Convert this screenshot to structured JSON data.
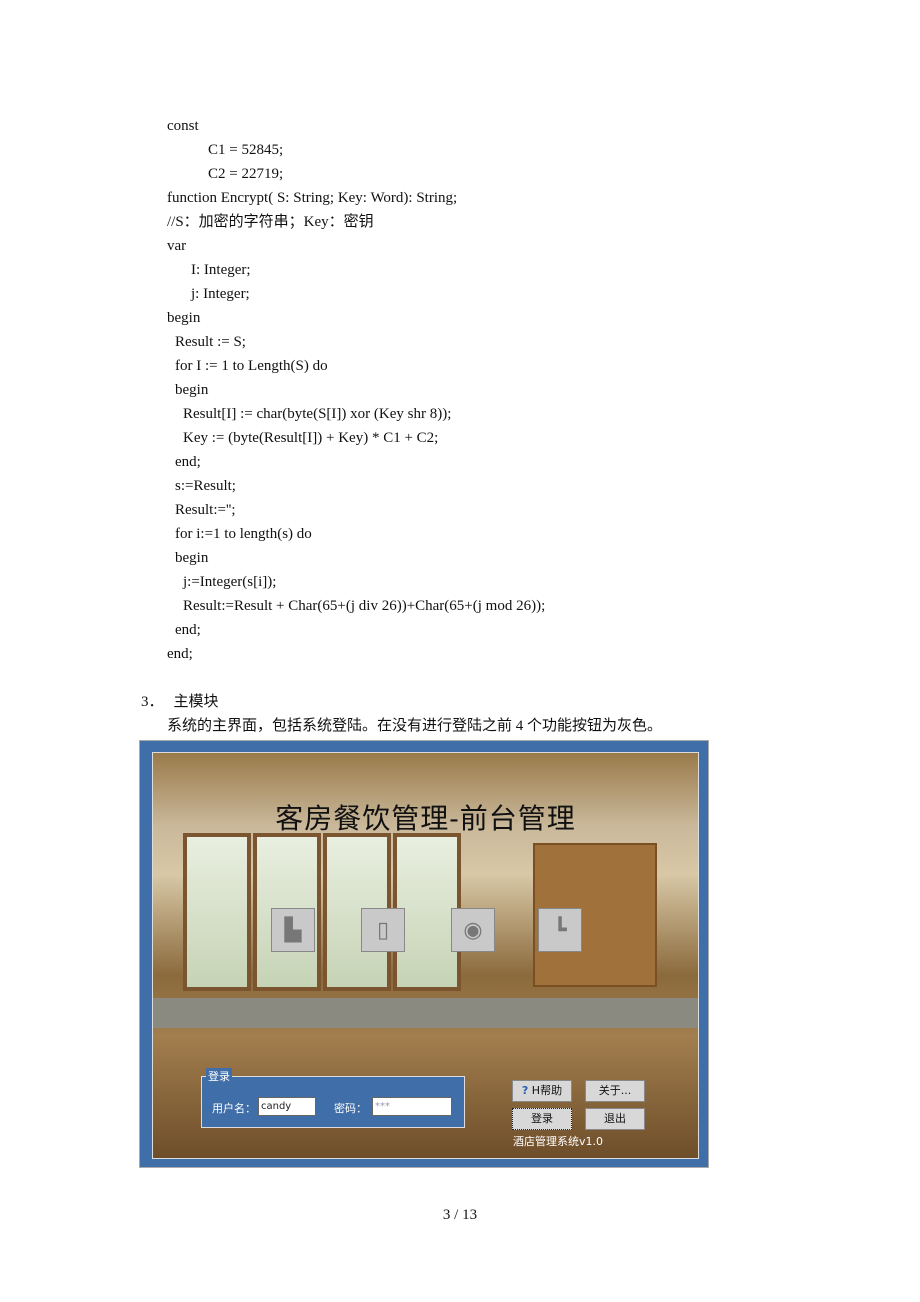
{
  "code_lines": [
    {
      "indent": 167,
      "text": "const"
    },
    {
      "indent": 208,
      "text": "C1 = 52845;"
    },
    {
      "indent": 208,
      "text": "C2 = 22719;"
    },
    {
      "indent": 167,
      "text": "function Encrypt( S: String; Key: Word): String;"
    },
    {
      "indent": 167,
      "text": "//S：加密的字符串；Key：密钥"
    },
    {
      "indent": 167,
      "text": "var"
    },
    {
      "indent": 191,
      "text": "I: Integer;"
    },
    {
      "indent": 191,
      "text": "j: Integer;"
    },
    {
      "indent": 167,
      "text": "begin"
    },
    {
      "indent": 175,
      "text": "Result := S;"
    },
    {
      "indent": 175,
      "text": "for I := 1 to Length(S) do"
    },
    {
      "indent": 175,
      "text": "begin"
    },
    {
      "indent": 183,
      "text": "Result[I] := char(byte(S[I]) xor (Key shr 8));"
    },
    {
      "indent": 183,
      "text": "Key := (byte(Result[I]) + Key) * C1 + C2;"
    },
    {
      "indent": 175,
      "text": "end;"
    },
    {
      "indent": 175,
      "text": "s:=Result;"
    },
    {
      "indent": 175,
      "text": "Result:='';"
    },
    {
      "indent": 175,
      "text": "for i:=1 to length(s) do"
    },
    {
      "indent": 175,
      "text": "begin"
    },
    {
      "indent": 183,
      "text": "j:=Integer(s[i]);"
    },
    {
      "indent": 183,
      "text": "Result:=Result + Char(65+(j div 26))+Char(65+(j mod 26));"
    },
    {
      "indent": 175,
      "text": "end;"
    },
    {
      "indent": 167,
      "text": "end;"
    }
  ],
  "section": {
    "number": "3．",
    "title": "主模块",
    "description": "系统的主界面，包括系统登陆。在没有进行登陆之前 4 个功能按钮为灰色。"
  },
  "screenshot": {
    "title": "客房餐饮管理-前台管理",
    "function_buttons": [
      {
        "icon": "room-icon",
        "enabled": false
      },
      {
        "icon": "clipboard-icon",
        "enabled": false
      },
      {
        "icon": "eye-icon",
        "enabled": false
      },
      {
        "icon": "chart-icon",
        "enabled": false
      }
    ],
    "login": {
      "legend": "登录",
      "username_label": "用户名：",
      "username_value": "candy",
      "password_label": "密码：",
      "password_value": "***"
    },
    "buttons": {
      "help": "H帮助",
      "about": "关于...",
      "login": "登录",
      "exit": "退出"
    },
    "version": "酒店管理系统v1.0",
    "colors": {
      "frame": "#3f6ea8"
    }
  },
  "footer": {
    "page": "3 / 13"
  }
}
